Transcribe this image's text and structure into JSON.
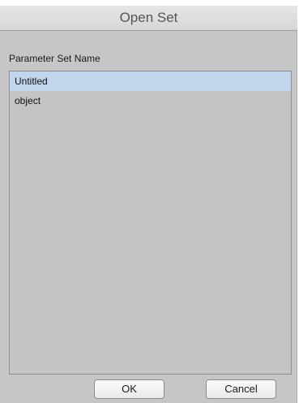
{
  "dialog": {
    "title": "Open Set",
    "field_label": "Parameter Set Name",
    "items": [
      {
        "label": "Untitled",
        "selected": true
      },
      {
        "label": "object",
        "selected": false
      }
    ],
    "buttons": {
      "ok": "OK",
      "cancel": "Cancel"
    }
  },
  "colors": {
    "dialog_background": "#c6c6c6",
    "selection": "#c2d6ee",
    "title_text": "#555555"
  }
}
